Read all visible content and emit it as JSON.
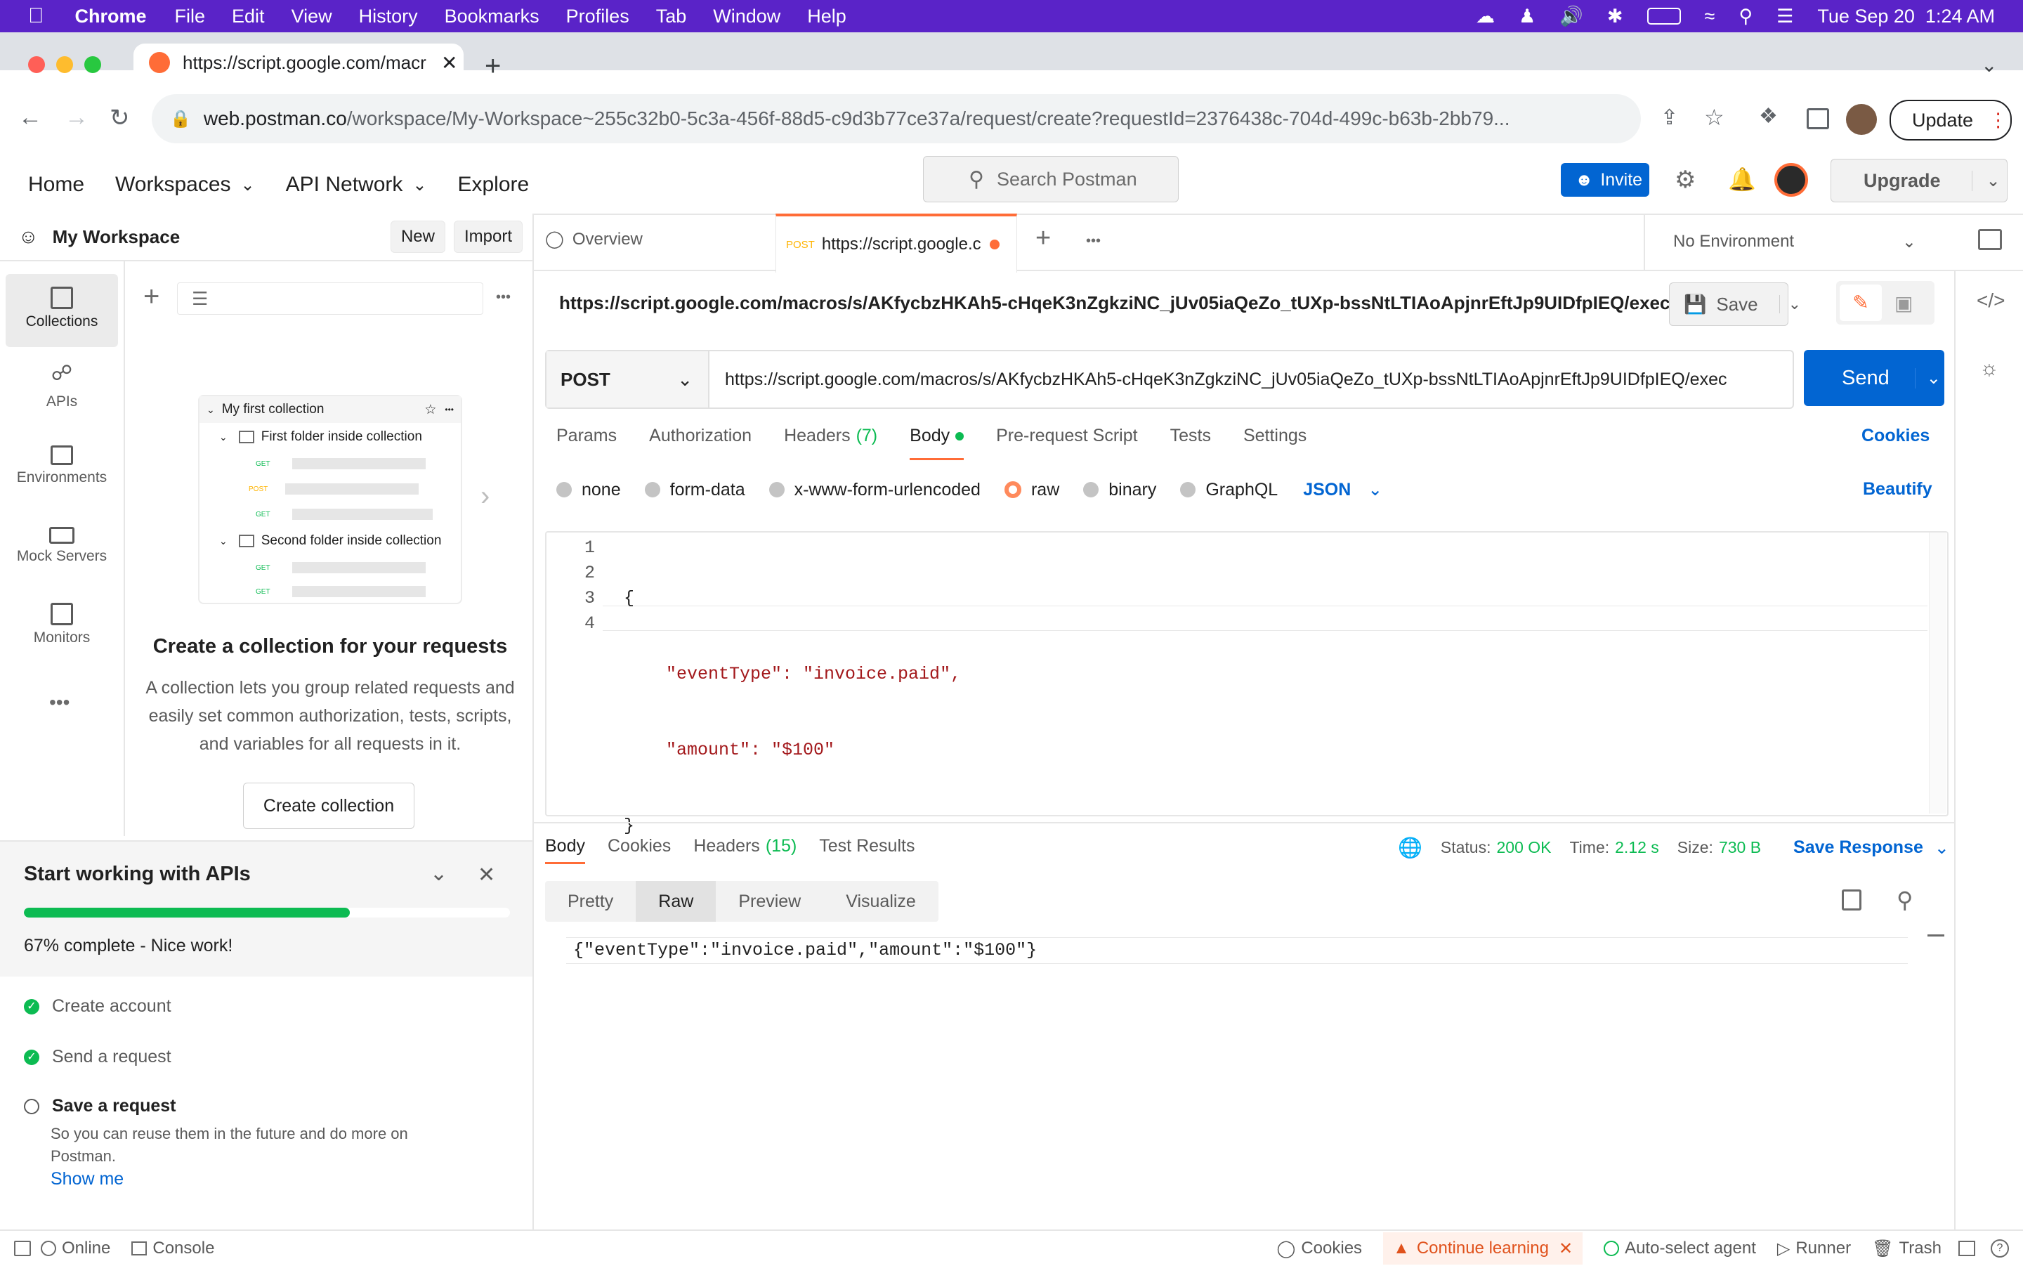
{
  "menubar": {
    "app": "Chrome",
    "items": [
      "File",
      "Edit",
      "View",
      "History",
      "Bookmarks",
      "Profiles",
      "Tab",
      "Window",
      "Help"
    ],
    "datetime": "Tue Sep 20  1:24 AM"
  },
  "browser": {
    "tab_title": "https://script.google.com/macr",
    "url_host": "web.postman.co",
    "url_path": "/workspace/My-Workspace~255c32b0-5c3a-456f-88d5-c9d3b77ce37a/request/create?requestId=2376438c-704d-499c-b63b-2bb79...",
    "update_label": "Update"
  },
  "header": {
    "nav": [
      "Home",
      "Workspaces",
      "API Network",
      "Explore"
    ],
    "search_placeholder": "Search Postman",
    "invite_label": "Invite",
    "upgrade_label": "Upgrade"
  },
  "sidebar": {
    "workspace_name": "My Workspace",
    "new_label": "New",
    "import_label": "Import",
    "rail": [
      "Collections",
      "APIs",
      "Environments",
      "Mock Servers",
      "Monitors"
    ],
    "illustration": {
      "collection": "My first collection",
      "folder1": "First folder inside collection",
      "folder2": "Second folder inside collection",
      "methods": [
        "GET",
        "POST",
        "GET",
        "GET",
        "GET"
      ]
    },
    "empty_title": "Create a collection for your requests",
    "empty_desc": "A collection lets you group related requests and easily set common authorization, tests, scripts, and variables for all requests in it.",
    "create_label": "Create collection"
  },
  "onboarding": {
    "title": "Start working with APIs",
    "progress_pct": 67,
    "progress_text": "67% complete - Nice work!",
    "steps": [
      {
        "label": "Create account",
        "done": true
      },
      {
        "label": "Send a request",
        "done": true
      },
      {
        "label": "Save a request",
        "done": false
      }
    ],
    "save_desc": "So you can reuse them in the future and do more on Postman.",
    "show_me": "Show me"
  },
  "tabs": {
    "overview": "Overview",
    "active_method": "POST",
    "active_url": "https://script.google.c",
    "environment": "No Environment"
  },
  "request": {
    "title_url": "https://script.google.com/macros/s/AKfycbzHKAh5-cHqeK3nZgkziNC_jUv05iaQeZo_tUXp-bssNtLTIAoApjnrEftJp9UIDfpIEQ/exec",
    "save_label": "Save",
    "method": "POST",
    "url": "https://script.google.com/macros/s/AKfycbzHKAh5-cHqeK3nZgkziNC_jUv05iaQeZo_tUXp-bssNtLTIAoApjnrEftJp9UIDfpIEQ/exec",
    "send_label": "Send",
    "subtabs": [
      "Params",
      "Authorization",
      "Headers",
      "Body",
      "Pre-request Script",
      "Tests",
      "Settings"
    ],
    "headers_count": "(7)",
    "cookies_label": "Cookies",
    "body_types": [
      "none",
      "form-data",
      "x-www-form-urlencoded",
      "raw",
      "binary",
      "GraphQL"
    ],
    "format": "JSON",
    "beautify_label": "Beautify",
    "code_lines": [
      "{",
      "\"eventType\": \"invoice.paid\",",
      "\"amount\": \"$100\"",
      "}"
    ],
    "line_numbers": [
      "1",
      "2",
      "3",
      "4"
    ]
  },
  "response": {
    "tabs": [
      "Body",
      "Cookies",
      "Headers",
      "Test Results"
    ],
    "headers_count": "(15)",
    "status_label": "Status:",
    "status_value": "200 OK",
    "time_label": "Time:",
    "time_value": "2.12 s",
    "size_label": "Size:",
    "size_value": "730 B",
    "save_response": "Save Response",
    "view_modes": [
      "Pretty",
      "Raw",
      "Preview",
      "Visualize"
    ],
    "raw_body": "{\"eventType\":\"invoice.paid\",\"amount\":\"$100\"}"
  },
  "statusbar": {
    "online": "Online",
    "console": "Console",
    "cookies": "Cookies",
    "continue_learning": "Continue learning",
    "auto_select": "Auto-select agent",
    "runner": "Runner",
    "trash": "Trash"
  },
  "colors": {
    "menubar": "#5a23c8",
    "accent_blue": "#0265d2",
    "accent_orange": "#ff6c37",
    "success_green": "#0cbb52"
  }
}
